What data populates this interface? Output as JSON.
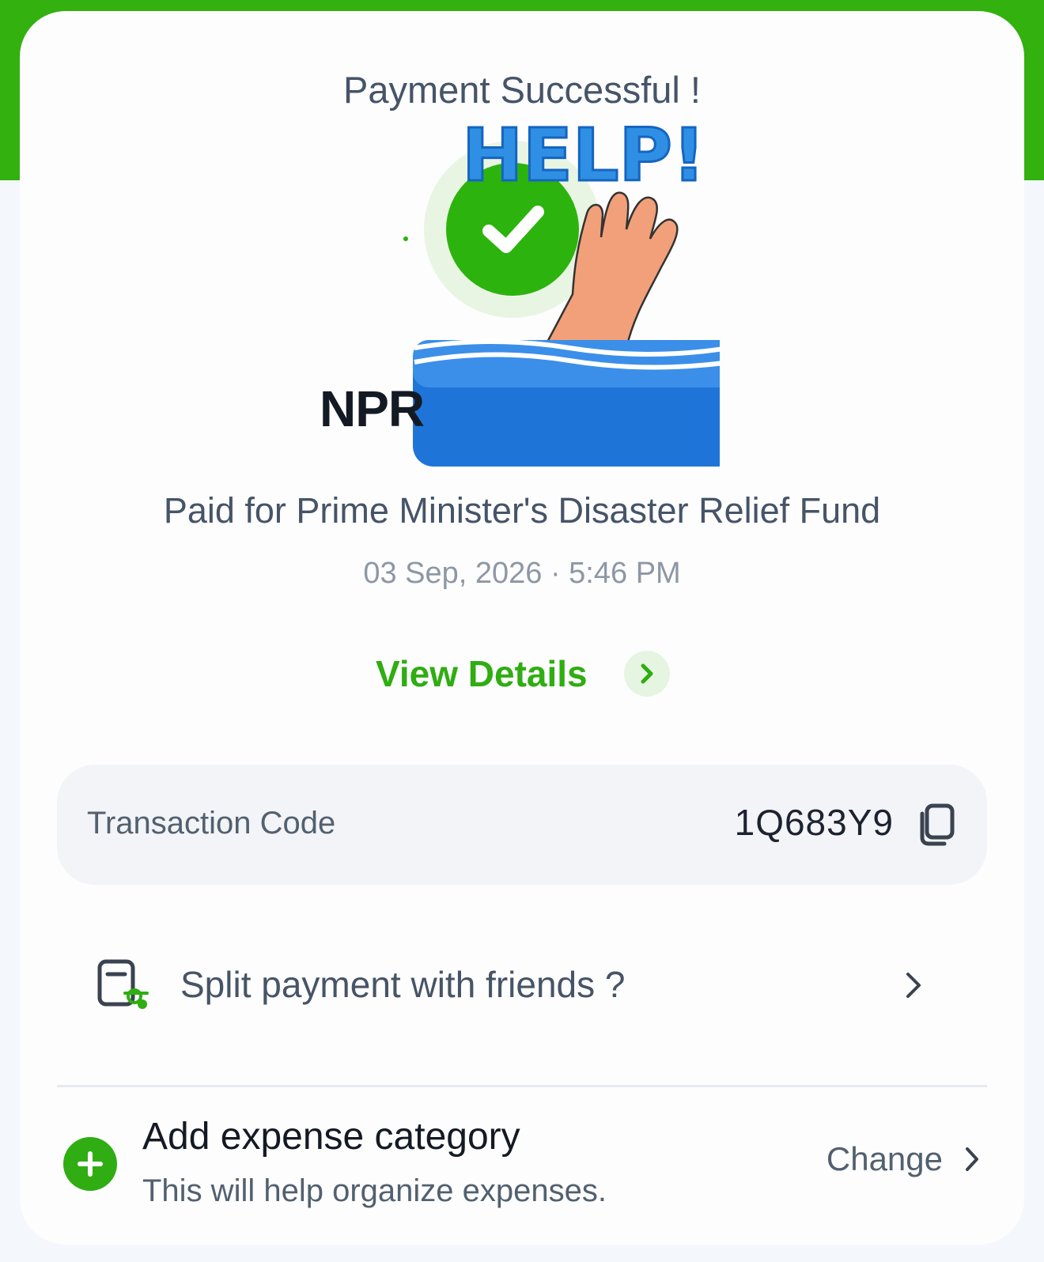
{
  "header": {
    "title": "Payment Successful !"
  },
  "sticker": {
    "text": "HELP!"
  },
  "payment": {
    "amount_prefix": "NPR",
    "paid_for": "Paid for Prime Minister's Disaster Relief Fund",
    "datetime": "03 Sep, 2026 · 5:46 PM",
    "view_details_label": "View Details"
  },
  "transaction": {
    "label": "Transaction Code",
    "code": "1Q683Y9"
  },
  "split": {
    "label": "Split payment with friends ?"
  },
  "expense": {
    "title": "Add expense category",
    "subtitle": "This will help organize expenses.",
    "change_label": "Change"
  },
  "colors": {
    "brand_green": "#32b10f",
    "text_primary": "#141a24",
    "text_secondary": "#465467"
  }
}
